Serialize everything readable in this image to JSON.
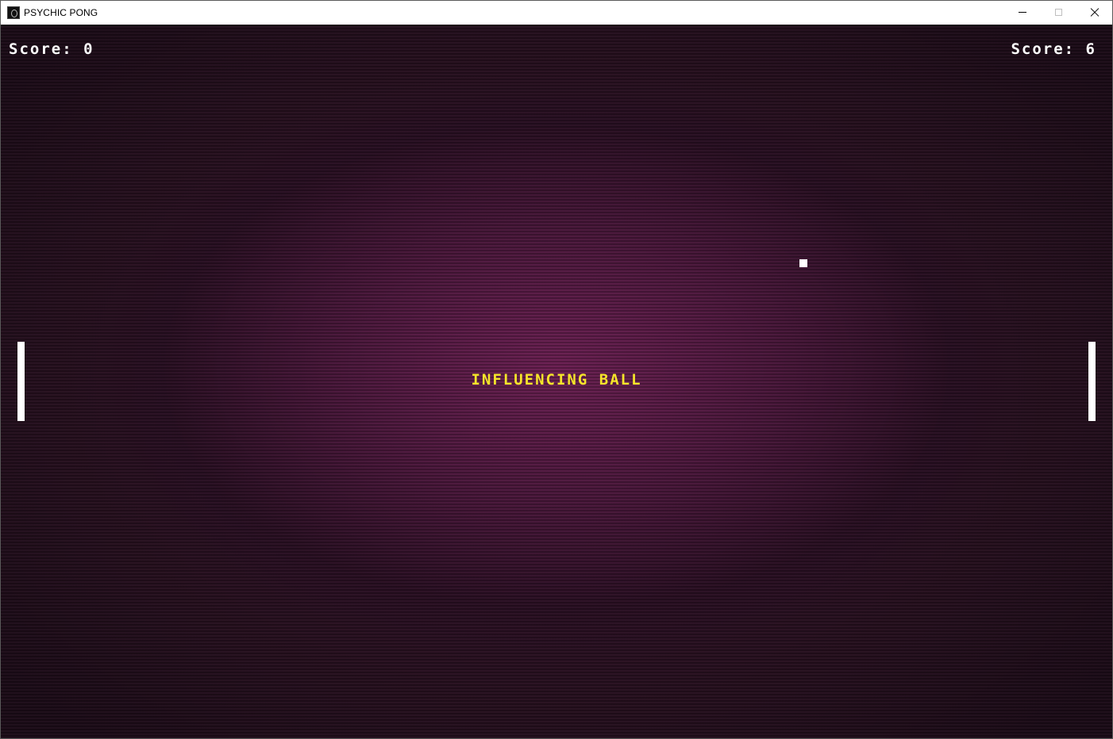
{
  "window": {
    "title": "PSYCHIC PONG",
    "icon": "app-icon",
    "controls": {
      "minimize_icon": "minimize-icon",
      "maximize_icon": "maximize-icon",
      "close_icon": "close-icon"
    }
  },
  "game": {
    "left_score": {
      "label": "Score:",
      "value": "0"
    },
    "right_score": {
      "label": "Score:",
      "value": "6"
    },
    "status_text": "INFLUENCING BALL",
    "colors": {
      "status": "#f5e52a",
      "foreground": "#ffffff",
      "background": "#3a1330"
    }
  }
}
